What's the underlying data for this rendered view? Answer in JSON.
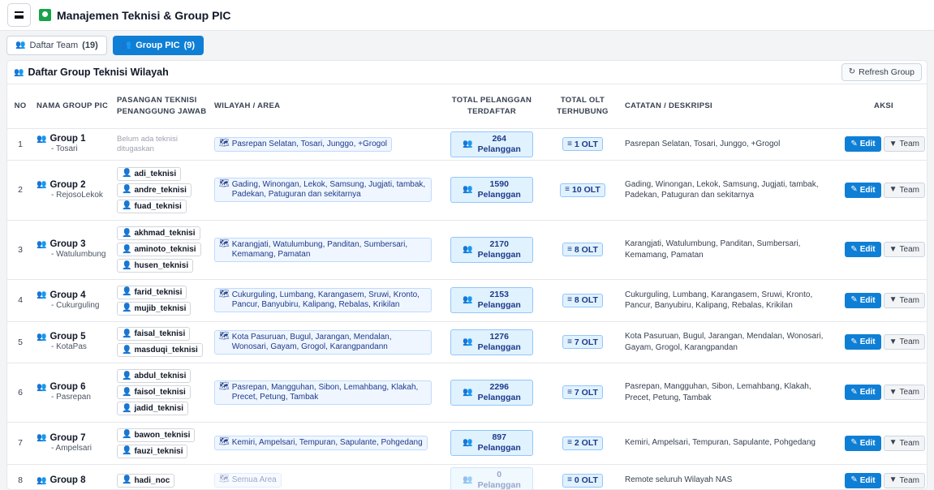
{
  "header": {
    "title": "Manajemen Teknisi & Group PIC"
  },
  "tabs": [
    {
      "name": "Daftar Team",
      "count": "(19)"
    },
    {
      "name": "Group PIC",
      "count": "(9)"
    }
  ],
  "card": {
    "title": "Daftar Group Teknisi Wilayah",
    "refresh_label": "Refresh Group"
  },
  "table": {
    "headers": {
      "no": "NO",
      "group": "NAMA GROUP PIC",
      "pasangan": "PASANGAN TEKNISI PENANGGUNG JAWAB",
      "wilayah": "WILAYAH / AREA",
      "pelanggan": "TOTAL PELANGGAN TERDAFTAR",
      "olt": "TOTAL OLT TERHUBUNG",
      "catatan": "CATATAN / DESKRIPSI",
      "aksi": "AKSI"
    },
    "edit_label": "Edit",
    "team_label": "Team",
    "empty_teknisi": "Belum ada teknisi ditugaskan",
    "rows": [
      {
        "no": "1",
        "name": "Group 1",
        "sub": "- Tosari",
        "teknisi": [],
        "area": "Pasrepan Selatan, Tosari, Junggo, +Grogol",
        "pel_num": "264",
        "pel_unit": "Pelanggan",
        "olt": "1 OLT",
        "note": "Pasrepan Selatan, Tosari, Junggo, +Grogol"
      },
      {
        "no": "2",
        "name": "Group 2",
        "sub": "- RejosoLekok",
        "teknisi": [
          "adi_teknisi",
          "andre_teknisi",
          "fuad_teknisi"
        ],
        "area": "Gading, Winongan, Lekok, Samsung, Jugjati, tambak, Padekan, Patuguran dan sekitarnya",
        "pel_num": "1590",
        "pel_unit": "Pelanggan",
        "olt": "10 OLT",
        "note": "Gading, Winongan, Lekok, Samsung, Jugjati, tambak, Padekan, Patuguran dan sekitarnya"
      },
      {
        "no": "3",
        "name": "Group 3",
        "sub": "- Watulumbung",
        "teknisi": [
          "akhmad_teknisi",
          "aminoto_teknisi",
          "husen_teknisi"
        ],
        "area": "Karangjati, Watulumbung, Panditan, Sumbersari, Kemamang, Pamatan",
        "pel_num": "2170",
        "pel_unit": "Pelanggan",
        "olt": "8 OLT",
        "note": "Karangjati, Watulumbung, Panditan, Sumbersari, Kemamang, Pamatan"
      },
      {
        "no": "4",
        "name": "Group 4",
        "sub": "- Cukurguling",
        "teknisi": [
          "farid_teknisi",
          "mujib_teknisi"
        ],
        "area": "Cukurguling, Lumbang, Karangasem, Sruwi, Kronto, Pancur, Banyubiru, Kalipang, Rebalas, Krikilan",
        "pel_num": "2153",
        "pel_unit": "Pelanggan",
        "olt": "8 OLT",
        "note": "Cukurguling, Lumbang, Karangasem, Sruwi, Kronto, Pancur, Banyubiru, Kalipang, Rebalas, Krikilan"
      },
      {
        "no": "5",
        "name": "Group 5",
        "sub": "- KotaPas",
        "teknisi": [
          "faisal_teknisi",
          "masduqi_teknisi"
        ],
        "area": "Kota Pasuruan, Bugul, Jarangan, Mendalan, Wonosari, Gayam, Grogol, Karangpandann",
        "pel_num": "1276",
        "pel_unit": "Pelanggan",
        "olt": "7 OLT",
        "note": "Kota Pasuruan, Bugul, Jarangan, Mendalan, Wonosari, Gayam, Grogol, Karangpandan"
      },
      {
        "no": "6",
        "name": "Group 6",
        "sub": "- Pasrepan",
        "teknisi": [
          "abdul_teknisi",
          "faisol_teknisi",
          "jadid_teknisi"
        ],
        "area": "Pasrepan, Mangguhan, Sibon, Lemahbang, Klakah, Precet, Petung, Tambak",
        "pel_num": "2296",
        "pel_unit": "Pelanggan",
        "olt": "7 OLT",
        "note": "Pasrepan, Mangguhan, Sibon, Lemahbang, Klakah, Precet, Petung, Tambak"
      },
      {
        "no": "7",
        "name": "Group 7",
        "sub": "- Ampelsari",
        "teknisi": [
          "bawon_teknisi",
          "fauzi_teknisi"
        ],
        "area": "Kemiri, Ampelsari, Tempuran, Sapulante, Pohgedang",
        "pel_num": "897",
        "pel_unit": "Pelanggan",
        "olt": "2 OLT",
        "note": "Kemiri, Ampelsari, Tempuran, Sapulante, Pohgedang"
      },
      {
        "no": "8",
        "name": "Group 8",
        "sub": "",
        "teknisi": [
          "hadi_noc"
        ],
        "area": "Semua Area",
        "pel_num": "0",
        "pel_unit": "Pelanggan",
        "olt": "0 OLT",
        "note": "Remote seluruh Wilayah NAS"
      }
    ]
  }
}
